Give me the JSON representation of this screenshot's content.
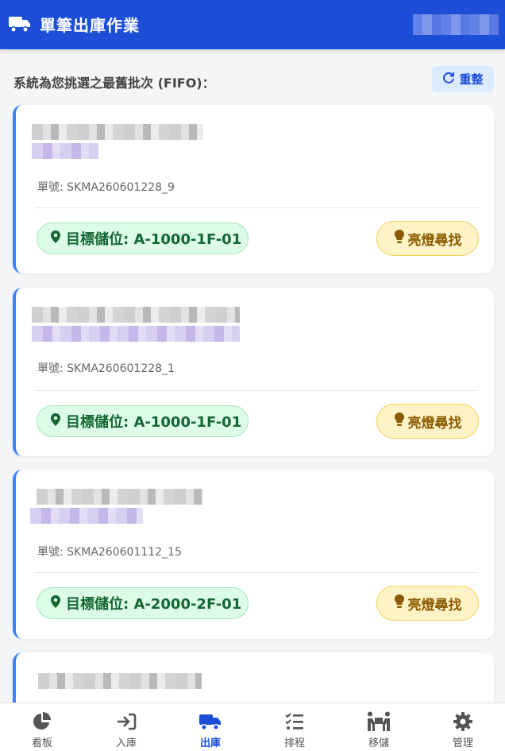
{
  "header": {
    "title": "單筆出庫作業",
    "truck_icon": "truck-icon"
  },
  "section": {
    "title": "系統為您挑選之最舊批次 (FIFO)："
  },
  "reset_button": {
    "label": "重整",
    "icon": "refresh-icon"
  },
  "cards": [
    {
      "order": "單號: SKMA260601228_9",
      "location": "目標儲位: A-1000-1F-01",
      "button": "亮燈尋找"
    },
    {
      "order": "單號: SKMA260601228_1",
      "location": "目標儲位: A-1000-1F-01",
      "button": "亮燈尋找"
    },
    {
      "order": "單號: SKMA260601112_15",
      "location": "目標儲位: A-2000-2F-01",
      "button": "亮燈尋找"
    }
  ],
  "tabs": [
    {
      "label": "看板",
      "icon": "pie-chart-icon"
    },
    {
      "label": "入庫",
      "icon": "sign-in-icon"
    },
    {
      "label": "出庫",
      "icon": "truck-icon",
      "active": true
    },
    {
      "label": "排程",
      "icon": "task-list-icon"
    },
    {
      "label": "移儲",
      "icon": "people-carry-icon"
    },
    {
      "label": "管理",
      "icon": "gear-icon"
    }
  ],
  "colors": {
    "primary": "#1d4ed8",
    "accent_border": "#3b82f6",
    "location_bg": "#dcfce7",
    "location_text": "#166534",
    "light_bg": "#fef3c7",
    "light_text": "#8a5a00"
  }
}
